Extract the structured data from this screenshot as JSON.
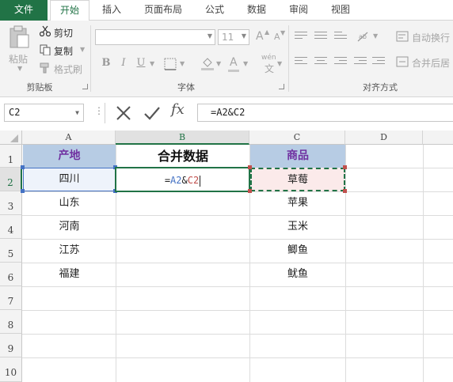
{
  "tabs": [
    {
      "label": "文件",
      "kind": "file"
    },
    {
      "label": "开始",
      "kind": "active"
    },
    {
      "label": "插入",
      "kind": "normal"
    },
    {
      "label": "页面布局",
      "kind": "normal"
    },
    {
      "label": "公式",
      "kind": "normal"
    },
    {
      "label": "数据",
      "kind": "normal"
    },
    {
      "label": "审阅",
      "kind": "normal"
    },
    {
      "label": "视图",
      "kind": "normal"
    }
  ],
  "ribbon": {
    "clipboard": {
      "paste": "粘贴",
      "cut": "剪切",
      "copy": "复制",
      "format_painter": "格式刷",
      "group_label": "剪贴板"
    },
    "font": {
      "size": "11",
      "group_label": "字体",
      "bold": "B",
      "italic": "I",
      "underline": "U",
      "font_color_letter": "A",
      "grow": "A",
      "shrink": "A",
      "wen": "wén",
      "wen_char": "文"
    },
    "alignment": {
      "wrap_text": "自动换行",
      "merge_center": "合并后居",
      "group_label": "对齐方式"
    }
  },
  "formula_bar": {
    "name_box": "C2",
    "fx": "fx",
    "formula": "=A2&C2"
  },
  "colors": {
    "accent": "#217346",
    "header_fill_blue": "#b7cce4",
    "header_text_purple": "#7030a0",
    "ref_blue": "#4472c4",
    "ref_red": "#c0504d",
    "ref_fill_blue": "#eef3fb",
    "ref_fill_red": "#fbeaea"
  },
  "sheet": {
    "columns": [
      "A",
      "B",
      "C",
      "D"
    ],
    "rows": [
      "1",
      "2",
      "3",
      "4",
      "5",
      "6",
      "7",
      "8",
      "9",
      "10"
    ],
    "headers": {
      "a": "产地",
      "b": "合并数据",
      "c": "商品"
    },
    "edit_text": {
      "eq": "=",
      "ref1": "A2",
      "amp": "&",
      "ref2": "C2"
    },
    "col_a": [
      "四川",
      "山东",
      "河南",
      "江苏",
      "福建"
    ],
    "col_c": [
      "草莓",
      "苹果",
      "玉米",
      "鲫鱼",
      "鱿鱼"
    ]
  }
}
